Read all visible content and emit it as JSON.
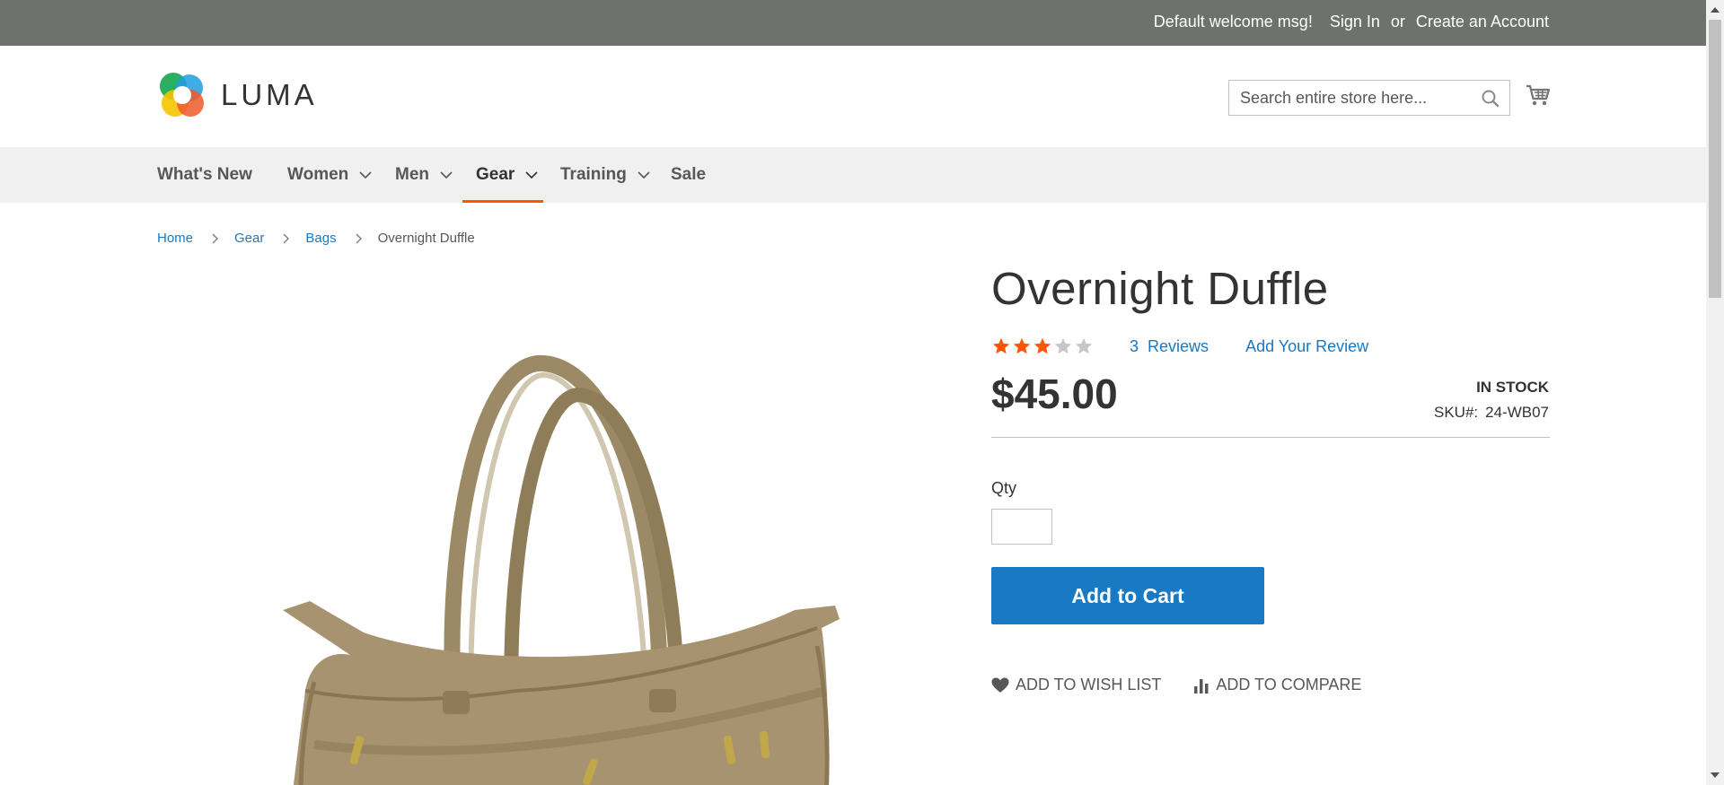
{
  "top_bar": {
    "welcome": "Default welcome msg!",
    "sign_in": "Sign In",
    "or": "or",
    "create_account": "Create an Account"
  },
  "header": {
    "logo_text": "LUMA",
    "search_placeholder": "Search entire store here...",
    "search_value": ""
  },
  "nav": {
    "items": [
      {
        "label": "What's New",
        "has_dropdown": false,
        "active": false
      },
      {
        "label": "Women",
        "has_dropdown": true,
        "active": false
      },
      {
        "label": "Men",
        "has_dropdown": true,
        "active": false
      },
      {
        "label": "Gear",
        "has_dropdown": true,
        "active": true
      },
      {
        "label": "Training",
        "has_dropdown": true,
        "active": false
      },
      {
        "label": "Sale",
        "has_dropdown": false,
        "active": false
      }
    ]
  },
  "breadcrumbs": [
    "Home",
    "Gear",
    "Bags",
    "Overnight Duffle"
  ],
  "product": {
    "title": "Overnight Duffle",
    "rating_stars": 3,
    "rating_max": 5,
    "reviews_count": "3",
    "reviews_label": "Reviews",
    "add_review": "Add Your Review",
    "price": "$45.00",
    "stock": "IN STOCK",
    "sku_label": "SKU#:",
    "sku": "24-WB07",
    "qty_label": "Qty",
    "qty_value": "",
    "add_to_cart": "Add to Cart",
    "add_to_wishlist": "ADD TO WISH LIST",
    "add_to_compare": "ADD TO COMPARE"
  },
  "colors": {
    "top_bar": "#6e716e",
    "nav_bg": "#f0f0f0",
    "nav_active_underline": "#ff5501",
    "link": "#1979c3",
    "primary_button": "#1979c3",
    "star_filled": "#ff5501",
    "star_empty": "#c7c7c7"
  }
}
